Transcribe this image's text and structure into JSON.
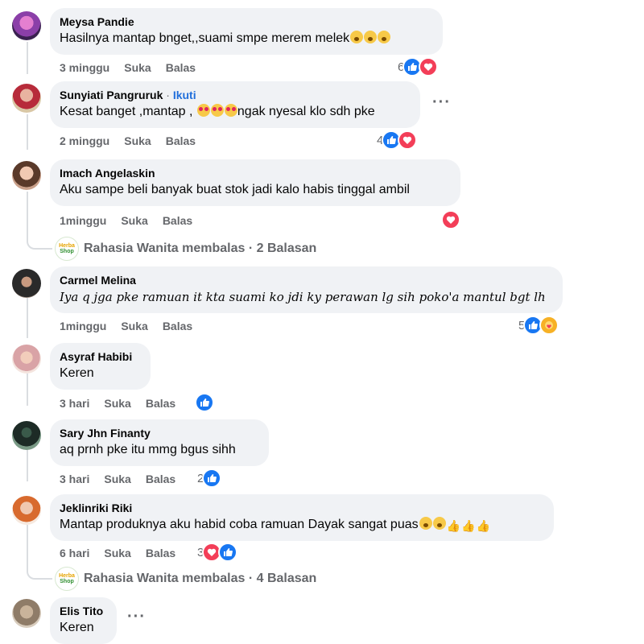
{
  "comments": [
    {
      "author": "Meysa Pandie",
      "follow": "",
      "text": "Hasilnya mantap bnget,,suami smpe merem melek",
      "emojis": [
        "shock",
        "shock",
        "shock"
      ],
      "time": "3 minggu",
      "like": "Suka",
      "reply": "Balas",
      "reactions": {
        "count": "6",
        "icons": [
          "like",
          "love"
        ]
      }
    },
    {
      "author": "Sunyiati Pangruruk",
      "follow": "Ikuti",
      "text_pre": "Kesat banget ,mantap ,",
      "emojis": [
        "heart-eyes",
        "heart-eyes",
        "heart-eyes"
      ],
      "text_post": "ngak nyesal klo sdh pke",
      "time": "2 minggu",
      "like": "Suka",
      "reply": "Balas",
      "reactions": {
        "count": "4",
        "icons": [
          "like",
          "love"
        ]
      }
    },
    {
      "author": "Imach Angelaskin",
      "follow": "",
      "text": "Aku sampe beli banyak buat stok jadi kalo habis tinggal ambil",
      "time": "1minggu",
      "like": "Suka",
      "reply": "Balas",
      "reactions": {
        "count": "",
        "icons": [
          "love"
        ]
      }
    },
    {
      "author": "Carmel Melina",
      "follow": "",
      "text": "Iya q jga pke ramuan it kta suami ko jdi ky perawan lg sih poko'a mantul bgt lh",
      "time": "1minggu",
      "like": "Suka",
      "reply": "Balas",
      "reactions": {
        "count": "5",
        "icons": [
          "like",
          "care"
        ]
      }
    },
    {
      "author": "Asyraf Habibi",
      "follow": "",
      "text": "Keren",
      "time": "3 hari",
      "like": "Suka",
      "reply": "Balas",
      "reactions": {
        "count": "",
        "icons": [
          "like"
        ]
      }
    },
    {
      "author": "Sary Jhn Finanty",
      "follow": "",
      "text": "aq prnh pke itu mmg bgus sihh",
      "time": "3 hari",
      "like": "Suka",
      "reply": "Balas",
      "reactions": {
        "count": "2",
        "icons": [
          "like"
        ]
      }
    },
    {
      "author": "Jeklinriki Riki",
      "follow": "",
      "text": "Mantap produknya aku habid coba ramuan Dayak sangat puas",
      "emojis": [
        "shock",
        "shock",
        "thumb",
        "thumb",
        "thumb"
      ],
      "time": "6 hari",
      "like": "Suka",
      "reply": "Balas",
      "reactions": {
        "count": "3",
        "icons": [
          "love",
          "like"
        ]
      }
    },
    {
      "author": "Elis Tito",
      "follow": "",
      "text": "Keren"
    }
  ],
  "replies": [
    {
      "page": "Rahasia Wanita membalas",
      "count": "2 Balasan",
      "logo_top": "Herba",
      "logo_bottom": "Shop"
    },
    {
      "page": "Rahasia Wanita membalas",
      "count": "4 Balasan",
      "logo_top": "Herba",
      "logo_bottom": "Shop"
    }
  ],
  "more_options": "···",
  "colors": {
    "bubble": "#f0f2f5",
    "like": "#1877f2",
    "love": "#f33e58",
    "care": "#f7b125",
    "muted": "#65676b",
    "follow": "#216fdb"
  }
}
